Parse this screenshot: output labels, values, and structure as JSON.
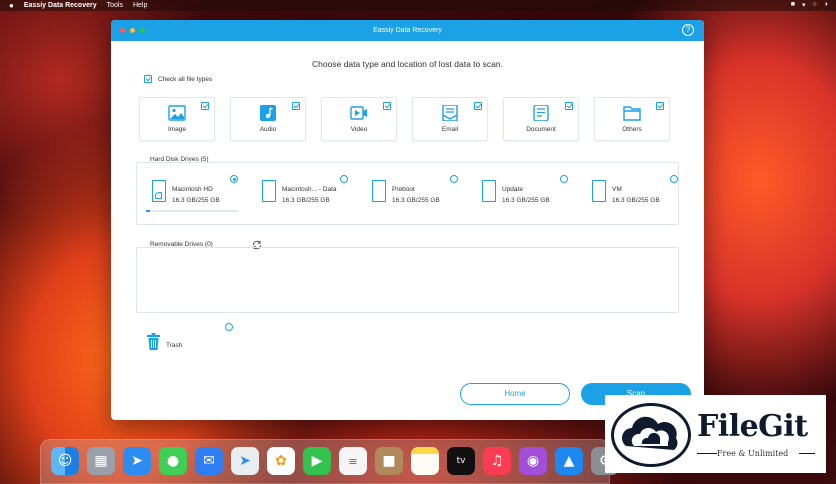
{
  "menubar": {
    "apple": "",
    "app_name": "Eassiy Data Recovery",
    "items": [
      "Tools",
      "Help"
    ]
  },
  "window": {
    "title": "Eassiy Data Recovery",
    "help_glyph": "?",
    "prompt": "Choose data type and location of lost data to scan.",
    "check_all_label": "Check all file types",
    "file_types": [
      {
        "label": "Image",
        "icon": "image-icon",
        "checked": true
      },
      {
        "label": "Audio",
        "icon": "audio-icon",
        "checked": true
      },
      {
        "label": "Video",
        "icon": "video-icon",
        "checked": true
      },
      {
        "label": "Email",
        "icon": "email-icon",
        "checked": true
      },
      {
        "label": "Document",
        "icon": "document-icon",
        "checked": true
      },
      {
        "label": "Others",
        "icon": "folder-icon",
        "checked": true
      }
    ],
    "hard_disk_label": "Hard Disk Drives (5)",
    "drives": [
      {
        "name": "Macintosh HD",
        "size": "16.3 GB/255 GB",
        "selected": true
      },
      {
        "name": "Macintosh... - Data",
        "size": "16.3 GB/255 GB",
        "selected": false
      },
      {
        "name": "Preboot",
        "size": "16.3 GB/255 GB",
        "selected": false
      },
      {
        "name": "Update",
        "size": "16.3 GB/255 GB",
        "selected": false
      },
      {
        "name": "VM",
        "size": "16.3 GB/255 GB",
        "selected": false
      }
    ],
    "removable_label": "Removable Drives (0)",
    "trash_label": "Trash",
    "home_button": "Home",
    "scan_button": "Scan"
  },
  "dock": {
    "apps": [
      "finder",
      "launchpad",
      "safari",
      "messages",
      "mail",
      "maps",
      "photos",
      "facetime",
      "reminders",
      "notes-book",
      "notes",
      "apple-tv",
      "music",
      "podcasts",
      "app-store",
      "system-preferences"
    ],
    "tv_label": "tv"
  },
  "watermark": {
    "title": "FileGit",
    "subtitle": "Free & Unlimited"
  },
  "colors": {
    "accent": "#1ba1e6",
    "window_bg": "#ffffff",
    "text": "#333333"
  }
}
